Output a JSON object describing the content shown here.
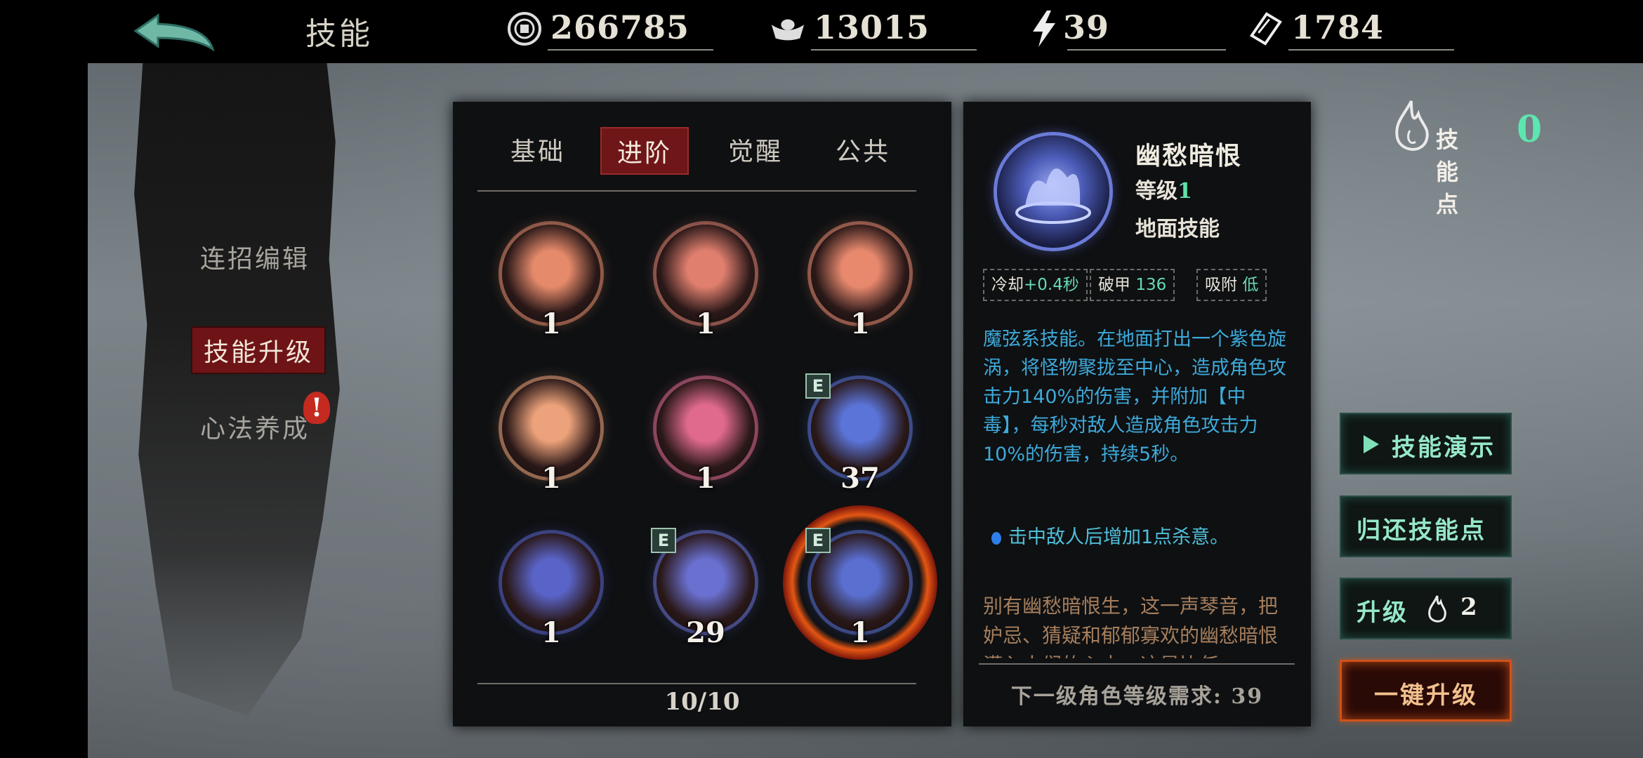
{
  "top_bar": {
    "title": "技能",
    "coins": "266785",
    "ingots": "13015",
    "energy": "39",
    "tickets": "1784"
  },
  "left_menu": {
    "items": [
      {
        "label": "连招编辑",
        "active": false
      },
      {
        "label": "技能升级",
        "active": true
      },
      {
        "label": "心法养成",
        "active": false,
        "alert": "!"
      }
    ]
  },
  "skills_panel": {
    "tabs": [
      {
        "label": "基础",
        "active": false
      },
      {
        "label": "进阶",
        "active": true
      },
      {
        "label": "觉醒",
        "active": false
      },
      {
        "label": "公共",
        "active": false
      }
    ],
    "skills": [
      {
        "level": "1",
        "color": "#e58a6a",
        "badge": ""
      },
      {
        "level": "1",
        "color": "#e07f6e",
        "badge": ""
      },
      {
        "level": "1",
        "color": "#e8896e",
        "badge": ""
      },
      {
        "level": "1",
        "color": "#eca27a",
        "badge": ""
      },
      {
        "level": "1",
        "color": "#e06a8e",
        "badge": ""
      },
      {
        "level": "37",
        "color": "#5b74d8",
        "badge": "E"
      },
      {
        "level": "1",
        "color": "#5a64c8",
        "badge": ""
      },
      {
        "level": "29",
        "color": "#6a70d0",
        "badge": "E"
      },
      {
        "level": "1",
        "color": "#5a6fd0",
        "badge": "E",
        "selected": true
      }
    ],
    "page": "10/10"
  },
  "detail": {
    "name": "幽愁暗恨",
    "level_label": "等级",
    "level_value": "1",
    "type": "地面技能",
    "stats": {
      "cooldown_label": "冷却",
      "cooldown_value": "+0.4秒",
      "armor_label": "破甲",
      "armor_value": "136",
      "absorb_label": "吸附",
      "absorb_value": "低"
    },
    "description": "魔弦系技能。在地面打出一个紫色旋涡，将怪物聚拢至中心，造成角色攻击力140%的伤害，并附加【中毒】，每秒对敌人造成角色攻击力10%的伤害，持续5秒。",
    "bonus": "击中敌人后增加1点杀意。",
    "lore": "别有幽愁暗恨生，这一声琴音，把妒忌、猜疑和郁郁寡欢的幽愁暗恨灌入人们的心中。这是比任",
    "next_requirement": "下一级角色等级需求: 39"
  },
  "right_panel": {
    "skill_points_label": "技能点",
    "skill_points_value": "0",
    "demo_button": "技能演示",
    "refund_button": "归还技能点",
    "upgrade_label": "升级",
    "upgrade_cost": "2",
    "one_click_button": "一键升级"
  },
  "colors": {
    "accent_red": "#6e1416",
    "accent_teal": "#5de6b0",
    "desc_blue": "#3ea9d9",
    "lore_brown": "#a67e5c"
  }
}
